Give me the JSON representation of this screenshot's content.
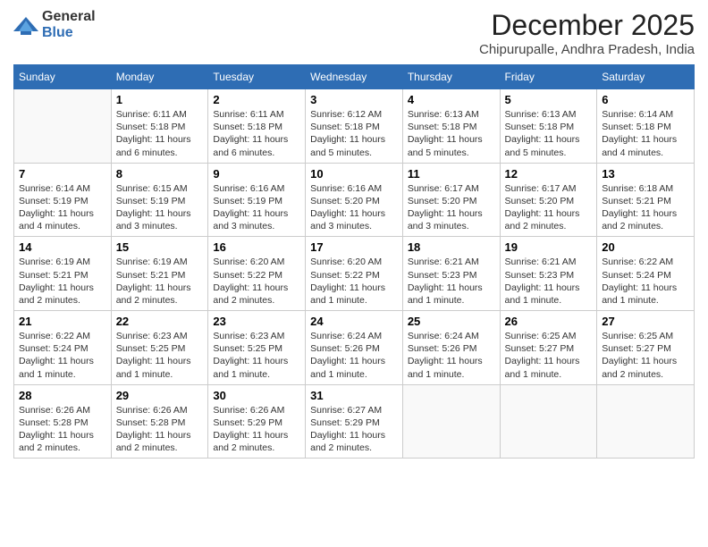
{
  "logo": {
    "general": "General",
    "blue": "Blue"
  },
  "header": {
    "month": "December 2025",
    "location": "Chipurupalle, Andhra Pradesh, India"
  },
  "weekdays": [
    "Sunday",
    "Monday",
    "Tuesday",
    "Wednesday",
    "Thursday",
    "Friday",
    "Saturday"
  ],
  "weeks": [
    [
      {
        "day": "",
        "sunrise": "",
        "sunset": "",
        "daylight": ""
      },
      {
        "day": "1",
        "sunrise": "Sunrise: 6:11 AM",
        "sunset": "Sunset: 5:18 PM",
        "daylight": "Daylight: 11 hours and 6 minutes."
      },
      {
        "day": "2",
        "sunrise": "Sunrise: 6:11 AM",
        "sunset": "Sunset: 5:18 PM",
        "daylight": "Daylight: 11 hours and 6 minutes."
      },
      {
        "day": "3",
        "sunrise": "Sunrise: 6:12 AM",
        "sunset": "Sunset: 5:18 PM",
        "daylight": "Daylight: 11 hours and 5 minutes."
      },
      {
        "day": "4",
        "sunrise": "Sunrise: 6:13 AM",
        "sunset": "Sunset: 5:18 PM",
        "daylight": "Daylight: 11 hours and 5 minutes."
      },
      {
        "day": "5",
        "sunrise": "Sunrise: 6:13 AM",
        "sunset": "Sunset: 5:18 PM",
        "daylight": "Daylight: 11 hours and 5 minutes."
      },
      {
        "day": "6",
        "sunrise": "Sunrise: 6:14 AM",
        "sunset": "Sunset: 5:18 PM",
        "daylight": "Daylight: 11 hours and 4 minutes."
      }
    ],
    [
      {
        "day": "7",
        "sunrise": "Sunrise: 6:14 AM",
        "sunset": "Sunset: 5:19 PM",
        "daylight": "Daylight: 11 hours and 4 minutes."
      },
      {
        "day": "8",
        "sunrise": "Sunrise: 6:15 AM",
        "sunset": "Sunset: 5:19 PM",
        "daylight": "Daylight: 11 hours and 3 minutes."
      },
      {
        "day": "9",
        "sunrise": "Sunrise: 6:16 AM",
        "sunset": "Sunset: 5:19 PM",
        "daylight": "Daylight: 11 hours and 3 minutes."
      },
      {
        "day": "10",
        "sunrise": "Sunrise: 6:16 AM",
        "sunset": "Sunset: 5:20 PM",
        "daylight": "Daylight: 11 hours and 3 minutes."
      },
      {
        "day": "11",
        "sunrise": "Sunrise: 6:17 AM",
        "sunset": "Sunset: 5:20 PM",
        "daylight": "Daylight: 11 hours and 3 minutes."
      },
      {
        "day": "12",
        "sunrise": "Sunrise: 6:17 AM",
        "sunset": "Sunset: 5:20 PM",
        "daylight": "Daylight: 11 hours and 2 minutes."
      },
      {
        "day": "13",
        "sunrise": "Sunrise: 6:18 AM",
        "sunset": "Sunset: 5:21 PM",
        "daylight": "Daylight: 11 hours and 2 minutes."
      }
    ],
    [
      {
        "day": "14",
        "sunrise": "Sunrise: 6:19 AM",
        "sunset": "Sunset: 5:21 PM",
        "daylight": "Daylight: 11 hours and 2 minutes."
      },
      {
        "day": "15",
        "sunrise": "Sunrise: 6:19 AM",
        "sunset": "Sunset: 5:21 PM",
        "daylight": "Daylight: 11 hours and 2 minutes."
      },
      {
        "day": "16",
        "sunrise": "Sunrise: 6:20 AM",
        "sunset": "Sunset: 5:22 PM",
        "daylight": "Daylight: 11 hours and 2 minutes."
      },
      {
        "day": "17",
        "sunrise": "Sunrise: 6:20 AM",
        "sunset": "Sunset: 5:22 PM",
        "daylight": "Daylight: 11 hours and 1 minute."
      },
      {
        "day": "18",
        "sunrise": "Sunrise: 6:21 AM",
        "sunset": "Sunset: 5:23 PM",
        "daylight": "Daylight: 11 hours and 1 minute."
      },
      {
        "day": "19",
        "sunrise": "Sunrise: 6:21 AM",
        "sunset": "Sunset: 5:23 PM",
        "daylight": "Daylight: 11 hours and 1 minute."
      },
      {
        "day": "20",
        "sunrise": "Sunrise: 6:22 AM",
        "sunset": "Sunset: 5:24 PM",
        "daylight": "Daylight: 11 hours and 1 minute."
      }
    ],
    [
      {
        "day": "21",
        "sunrise": "Sunrise: 6:22 AM",
        "sunset": "Sunset: 5:24 PM",
        "daylight": "Daylight: 11 hours and 1 minute."
      },
      {
        "day": "22",
        "sunrise": "Sunrise: 6:23 AM",
        "sunset": "Sunset: 5:25 PM",
        "daylight": "Daylight: 11 hours and 1 minute."
      },
      {
        "day": "23",
        "sunrise": "Sunrise: 6:23 AM",
        "sunset": "Sunset: 5:25 PM",
        "daylight": "Daylight: 11 hours and 1 minute."
      },
      {
        "day": "24",
        "sunrise": "Sunrise: 6:24 AM",
        "sunset": "Sunset: 5:26 PM",
        "daylight": "Daylight: 11 hours and 1 minute."
      },
      {
        "day": "25",
        "sunrise": "Sunrise: 6:24 AM",
        "sunset": "Sunset: 5:26 PM",
        "daylight": "Daylight: 11 hours and 1 minute."
      },
      {
        "day": "26",
        "sunrise": "Sunrise: 6:25 AM",
        "sunset": "Sunset: 5:27 PM",
        "daylight": "Daylight: 11 hours and 1 minute."
      },
      {
        "day": "27",
        "sunrise": "Sunrise: 6:25 AM",
        "sunset": "Sunset: 5:27 PM",
        "daylight": "Daylight: 11 hours and 2 minutes."
      }
    ],
    [
      {
        "day": "28",
        "sunrise": "Sunrise: 6:26 AM",
        "sunset": "Sunset: 5:28 PM",
        "daylight": "Daylight: 11 hours and 2 minutes."
      },
      {
        "day": "29",
        "sunrise": "Sunrise: 6:26 AM",
        "sunset": "Sunset: 5:28 PM",
        "daylight": "Daylight: 11 hours and 2 minutes."
      },
      {
        "day": "30",
        "sunrise": "Sunrise: 6:26 AM",
        "sunset": "Sunset: 5:29 PM",
        "daylight": "Daylight: 11 hours and 2 minutes."
      },
      {
        "day": "31",
        "sunrise": "Sunrise: 6:27 AM",
        "sunset": "Sunset: 5:29 PM",
        "daylight": "Daylight: 11 hours and 2 minutes."
      },
      {
        "day": "",
        "sunrise": "",
        "sunset": "",
        "daylight": ""
      },
      {
        "day": "",
        "sunrise": "",
        "sunset": "",
        "daylight": ""
      },
      {
        "day": "",
        "sunrise": "",
        "sunset": "",
        "daylight": ""
      }
    ]
  ]
}
